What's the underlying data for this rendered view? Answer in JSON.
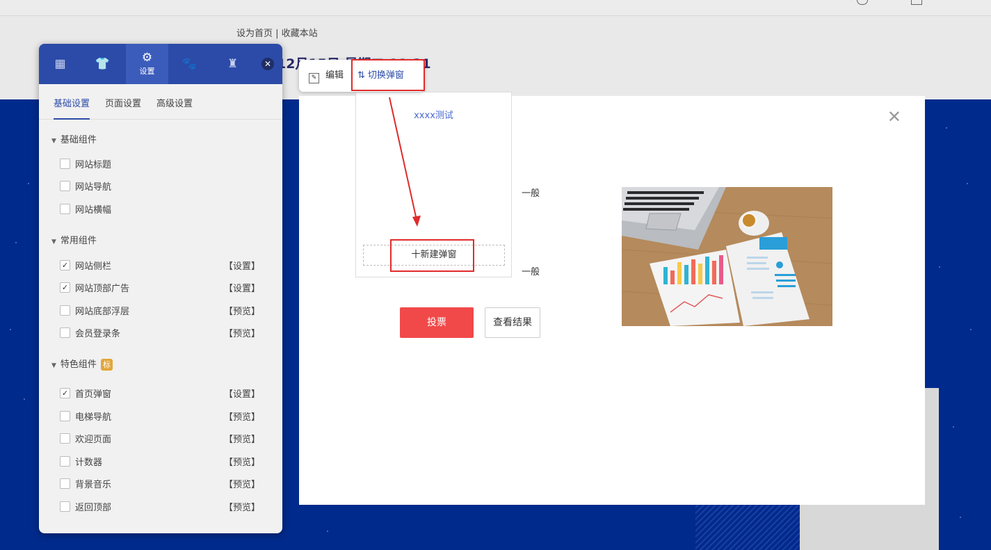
{
  "header": {
    "links": "设为首页 | 收藏本站",
    "date": "12月15日 星期二 11:21"
  },
  "panel": {
    "tabs": [
      {
        "icon": "grid-icon",
        "label": ""
      },
      {
        "icon": "shirt-icon",
        "label": ""
      },
      {
        "icon": "gear-icon",
        "label": "设置"
      },
      {
        "icon": "paw-icon",
        "label": ""
      },
      {
        "icon": "robot-icon",
        "label": ""
      }
    ],
    "subtabs": [
      "基础设置",
      "页面设置",
      "高级设置"
    ],
    "groups": [
      {
        "title": "基础组件",
        "badge": "",
        "items": [
          {
            "name": "网站标题",
            "checked": false,
            "action": ""
          },
          {
            "name": "网站导航",
            "checked": false,
            "action": ""
          },
          {
            "name": "网站横幅",
            "checked": false,
            "action": ""
          }
        ]
      },
      {
        "title": "常用组件",
        "badge": "",
        "items": [
          {
            "name": "网站侧栏",
            "checked": true,
            "action": "【设置】"
          },
          {
            "name": "网站顶部广告",
            "checked": true,
            "action": "【设置】"
          },
          {
            "name": "网站底部浮层",
            "checked": false,
            "action": "【预览】"
          },
          {
            "name": "会员登录条",
            "checked": false,
            "action": "【预览】"
          }
        ]
      },
      {
        "title": "特色组件",
        "badge": "标",
        "items": [
          {
            "name": "首页弹窗",
            "checked": true,
            "action": "【设置】"
          },
          {
            "name": "电梯导航",
            "checked": false,
            "action": "【预览】"
          },
          {
            "name": "欢迎页面",
            "checked": false,
            "action": "【预览】"
          },
          {
            "name": "计数器",
            "checked": false,
            "action": "【预览】"
          },
          {
            "name": "背景音乐",
            "checked": false,
            "action": "【预览】"
          },
          {
            "name": "返回顶部",
            "checked": false,
            "action": "【预览】"
          }
        ]
      }
    ]
  },
  "toolbar": {
    "edit_label": "编辑",
    "switch_label": "切换弹窗"
  },
  "dropdown": {
    "item": "xxxx测试",
    "new_label": "十新建弹窗"
  },
  "dialog": {
    "option1": "一般",
    "option2": "一般",
    "vote_label": "投票",
    "result_label": "查看结果"
  },
  "colors": {
    "accent": "#2c4ba8",
    "vote": "#f14949",
    "highlight": "#e02b2b",
    "background": "#002a8c"
  }
}
